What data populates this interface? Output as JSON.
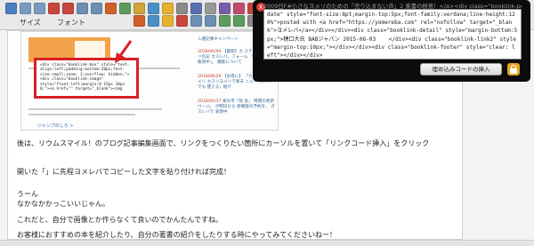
{
  "toolbar": {
    "row1_buttons": [
      {
        "icon": "pro-icon",
        "color": "#4a7fc1"
      },
      {
        "icon": "undo-icon",
        "color": "#7a9bbf"
      },
      {
        "icon": "redo-icon",
        "color": "#7a9bbf"
      },
      {
        "icon": "bold-icon",
        "color": "#c9463d"
      },
      {
        "icon": "italic-icon",
        "color": "#c9463d"
      },
      {
        "icon": "align-icon",
        "color": "#6c8fb3"
      },
      {
        "icon": "list-icon",
        "color": "#6c8fb3"
      },
      {
        "icon": "color-icon",
        "color": "#d15f2a"
      },
      {
        "icon": "table-icon",
        "color": "#5c9c5c"
      },
      {
        "icon": "image-icon",
        "color": "#d0a43b"
      },
      {
        "icon": "link-icon",
        "color": "#4a90c8"
      },
      {
        "icon": "emoji-icon",
        "color": "#e6b12f"
      },
      {
        "icon": "quote-icon",
        "color": "#8a8a8a"
      },
      {
        "icon": "code-icon",
        "color": "#5a6fb0"
      },
      {
        "icon": "hr-icon",
        "color": "#999999"
      },
      {
        "icon": "heading-icon",
        "color": "#7a5da8"
      },
      {
        "icon": "grid-icon",
        "color": "#c04a6b"
      },
      {
        "icon": "video-icon",
        "color": "#c9463d"
      },
      {
        "icon": "map-icon",
        "color": "#4aa05a"
      },
      {
        "icon": "box-icon",
        "color": "#d18b2a"
      },
      {
        "icon": "note-icon",
        "color": "#3f83c2"
      },
      {
        "icon": "more-icon",
        "color": "#888888"
      }
    ],
    "row2_buttons": [
      {
        "icon": "size-icon",
        "color": "#d15f2a"
      },
      {
        "icon": "font-icon",
        "color": "#4a90c8"
      },
      {
        "icon": "marker-icon",
        "color": "#e6b12f"
      },
      {
        "icon": "strike-icon",
        "color": "#c9463d"
      },
      {
        "icon": "sup-icon",
        "color": "#6c8fb3"
      },
      {
        "icon": "sub-icon",
        "color": "#6c8fb3"
      },
      {
        "icon": "indent-icon",
        "color": "#5c9c5c"
      },
      {
        "icon": "outdent-icon",
        "color": "#5c9c5c"
      },
      {
        "icon": "char-icon",
        "color": "#8a8a8a"
      },
      {
        "icon": "clear-icon",
        "color": "#c04a6b"
      },
      {
        "icon": "paste-icon",
        "color": "#d0a43b"
      },
      {
        "icon": "find-icon",
        "color": "#4a7fc1"
      },
      {
        "icon": "spell-icon",
        "color": "#7a5da8"
      },
      {
        "icon": "anchor-icon",
        "color": "#3f83c2"
      },
      {
        "icon": "source-icon",
        "color": "#999999"
      },
      {
        "icon": "full-icon",
        "color": "#5a6fb0"
      }
    ],
    "size_label": "サイズ",
    "font_label": "フォント"
  },
  "editor": {
    "screenshot": {
      "side_entries": [
        {
          "date": "",
          "text": "入選記事キャンペーン"
        },
        {
          "date": "2018/06/04",
          "text": "【最新】カ ステレバ、ヨメリの記 カスレバ。フォーム 「最新作品を 販売中」。 機能について"
        },
        {
          "date": "2018/06/29",
          "text": "【お得に】 「カスレバ」「ヨメリ カスリヨメリで楽天 ニュー カスレバでも 使える」紹介"
        },
        {
          "date": "2018/04/17",
          "text": "楽天市「照 会」 時間の更新 ページ。 が明日から 新機能の予約を、 ガスレバで 表現中"
        }
      ],
      "code_snippet": "<div class=\"booklink-box\" style=\"text-align:left;padding-bottom:20px;font-size:small;zoom: 1;overflow: hidden;\"><div class=\"booklink-image\" style=\"float:left;margin:0 15px 10px 0;\"><a href=\"\" target=\"_blank\"><img",
      "link_text": "ジャンプのしろ >"
    },
    "paragraphs": [
      "後は、リウムスマイル！のブログ記事編集画面で、リンクをつくりたい箇所にカーソルを置いて「リンクコード挿入」をクリック",
      "開いた「」に先程ヨメレバでコピーした文字を貼り付ければ完成！",
      "うーん",
      "なかなかかっこいいじゃん。",
      "これだと、自分で画像とか作らなくて良いのでかんたんですね。",
      "お客様におすすめの本を紹介したり、自分の著書の紹介をしたりする時にやってみてくださいねー！"
    ]
  },
  "popup": {
    "close_label": "x",
    "pre_text": "2009日F#小さなヨメリのための「売り込まない声」2 楽書の極意）</a><div class=\"booklink-powered-",
    "code": "date\" style=\"font-size:8pt;margin-top:5px;font-family:verdana;line-height:120%\">posted with <a href=\"https://yomereba.com\" rel=\"nofollow\" target=\"_blank\">ヨメレバ</a></div></div><div class=\"booklink-detail\" style=\"margin-bottom:5px;\">穂口大氏 BABジャパン 2015-06-03    </div><div class=\"booklink-link2\" style=\"margin-top:10px;\"></div></div><div class=\"booklink-footer\" style=\"clear: left\"></div></div>",
    "insert_button": "埋め込みコードの挿入"
  }
}
